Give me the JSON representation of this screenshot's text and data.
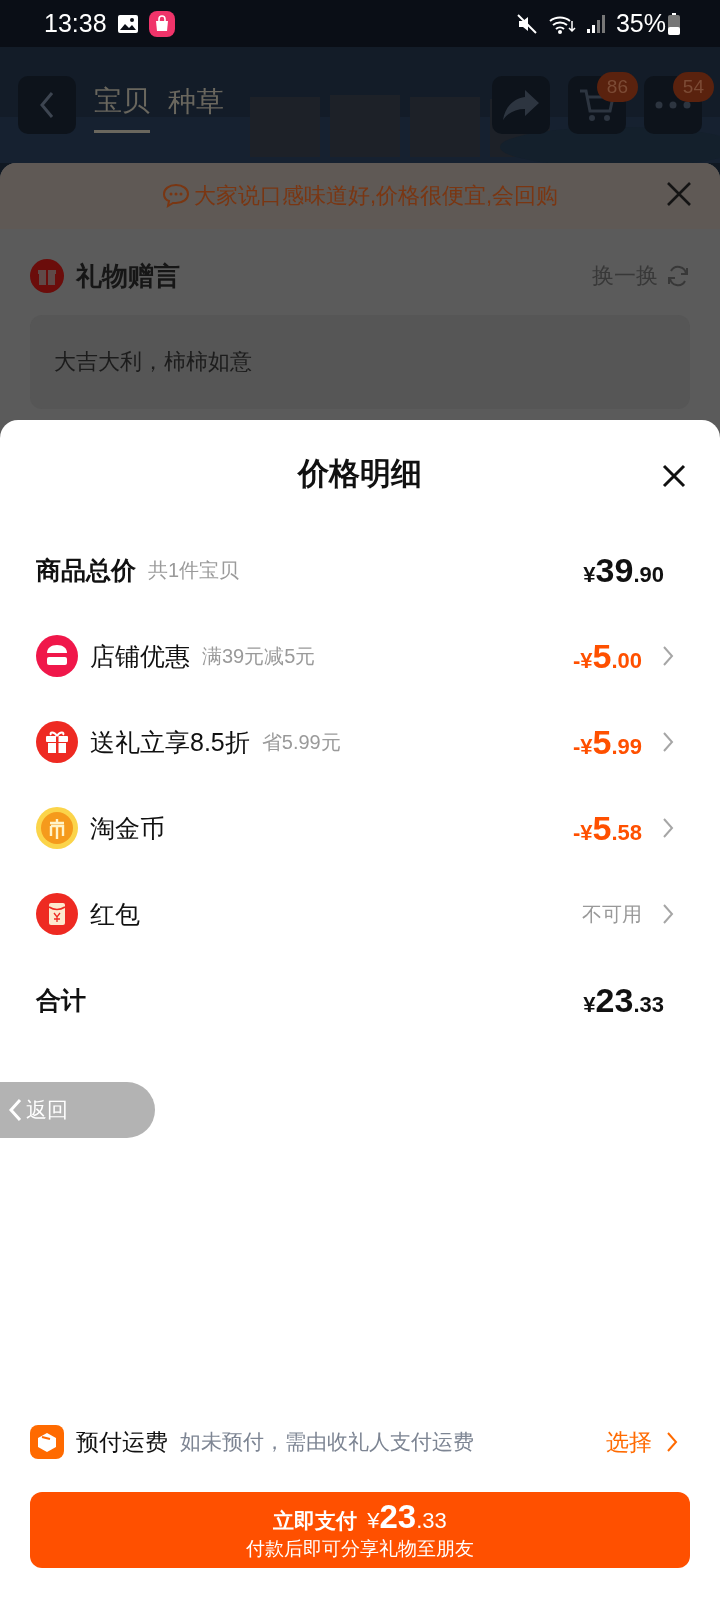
{
  "status_bar": {
    "time": "13:38",
    "battery": "35%"
  },
  "header": {
    "tabs": [
      {
        "label": "宝贝",
        "selected": true
      },
      {
        "label": "种草",
        "selected": false
      }
    ],
    "cart_badge": "86",
    "more_badge": "54"
  },
  "gift_panel": {
    "notice": "大家说口感味道好,价格很便宜,会回购",
    "title": "礼物赠言",
    "refresh": "换一换",
    "message": "大吉大利，柿柿如意"
  },
  "price_detail": {
    "title": "价格明细",
    "rows": [
      {
        "kind": "subtotal",
        "label": "商品总价",
        "note": "共1件宝贝",
        "amount": {
          "prefix": "¥",
          "integer": "39",
          "decimal": ".90"
        }
      },
      {
        "kind": "store",
        "label": "店铺优惠",
        "note": "满39元减5元",
        "amount": {
          "prefix": "-¥",
          "integer": "5",
          "decimal": ".00"
        }
      },
      {
        "kind": "gift",
        "label": "送礼立享8.5折",
        "note": "省5.99元",
        "amount": {
          "prefix": "-¥",
          "integer": "5",
          "decimal": ".99"
        }
      },
      {
        "kind": "coin",
        "label": "淘金币",
        "amount": {
          "prefix": "-¥",
          "integer": "5",
          "decimal": ".58"
        }
      },
      {
        "kind": "packet",
        "label": "红包",
        "status": "不可用"
      },
      {
        "kind": "total",
        "label": "合计",
        "amount": {
          "prefix": "¥",
          "integer": "23",
          "decimal": ".33"
        }
      }
    ],
    "back": "返回",
    "shipping": {
      "label": "预付运费",
      "note": "如未预付，需由收礼人支付运费",
      "action": "选择"
    },
    "pay_button": {
      "label": "立即支付",
      "amount": {
        "prefix": "¥",
        "integer": "23",
        "decimal": ".33"
      },
      "subtitle": "付款后即可分享礼物至朋友"
    }
  }
}
